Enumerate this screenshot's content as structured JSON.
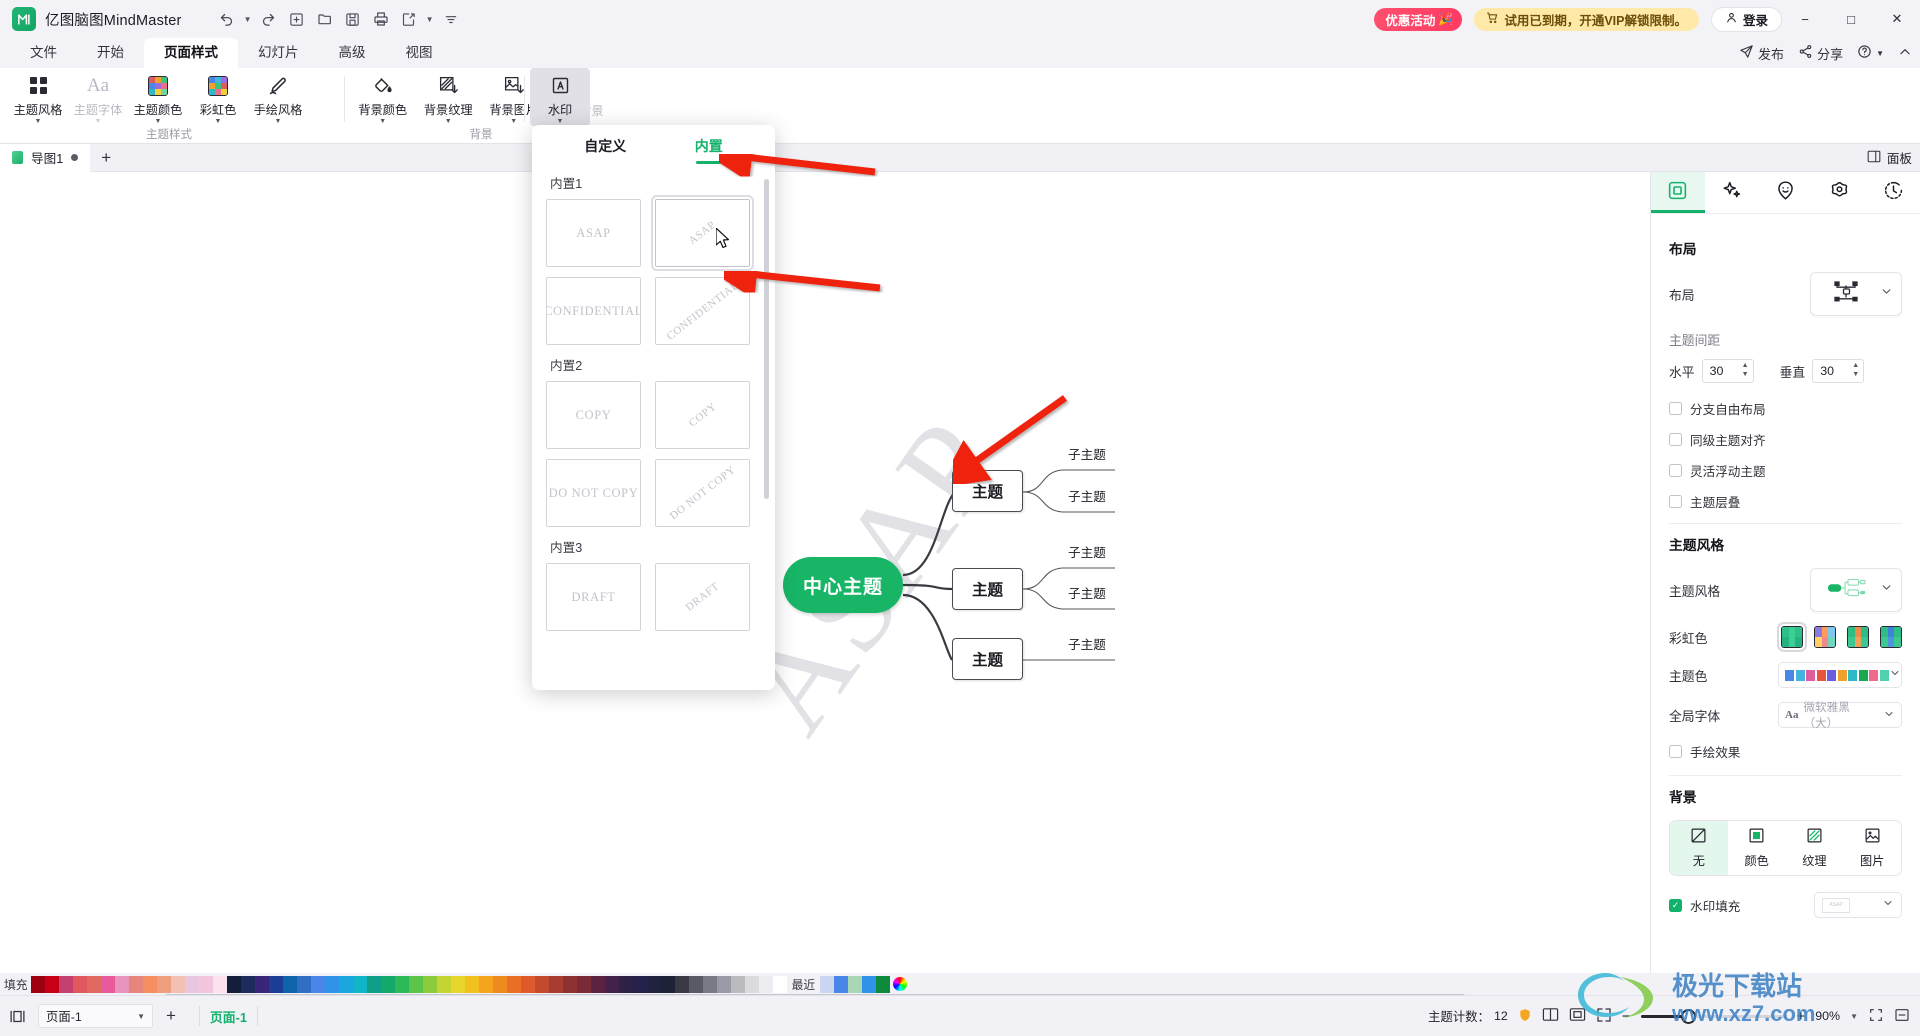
{
  "titlebar": {
    "app_name": "亿图脑图MindMaster",
    "logo_glyph": "M",
    "quick_access": [
      {
        "name": "undo-button",
        "glyph": "↶",
        "caret": true
      },
      {
        "name": "redo-button",
        "glyph": "↷",
        "caret": false
      },
      {
        "name": "new-button",
        "glyph": "⊞",
        "caret": false
      },
      {
        "name": "open-button",
        "glyph": "🗁",
        "caret": false
      },
      {
        "name": "save-button",
        "glyph": "🖫",
        "caret": false
      },
      {
        "name": "print-button",
        "glyph": "🖨",
        "caret": false
      },
      {
        "name": "export-button",
        "glyph": "🗇",
        "caret": true
      },
      {
        "name": "more-button",
        "glyph": "⩲",
        "caret": false
      }
    ],
    "promo_label": "优惠活动",
    "vip_label": "试用已到期，开通VIP解锁限制。",
    "login_label": "登录",
    "minimize": "−",
    "maximize": "□",
    "close": "✕"
  },
  "ribbon": {
    "tabs": [
      {
        "label": "文件",
        "active": false
      },
      {
        "label": "开始",
        "active": false
      },
      {
        "label": "页面样式",
        "active": true
      },
      {
        "label": "幻灯片",
        "active": false
      },
      {
        "label": "高级",
        "active": false
      },
      {
        "label": "视图",
        "active": false
      }
    ],
    "right_actions": [
      {
        "label": "发布",
        "icon": "send-icon"
      },
      {
        "label": "分享",
        "icon": "share-icon"
      },
      {
        "label": "",
        "icon": "help-icon"
      },
      {
        "label": "",
        "icon": "collapse-icon"
      }
    ],
    "groups": [
      {
        "name": "主题样式",
        "buttons": [
          {
            "label": "主题风格",
            "icon": "grid-icon",
            "disabled": false,
            "caret": true,
            "selected": false
          },
          {
            "label": "主题字体",
            "icon": "font-icon",
            "disabled": true,
            "caret": true,
            "selected": false
          },
          {
            "label": "主题颜色",
            "icon": "palette-icon",
            "disabled": false,
            "caret": true,
            "selected": false
          },
          {
            "label": "彩虹色",
            "icon": "rainbow-icon",
            "disabled": false,
            "caret": true,
            "selected": false
          },
          {
            "label": "手绘风格",
            "icon": "pen-icon",
            "disabled": false,
            "caret": true,
            "selected": false
          }
        ]
      },
      {
        "name": "背景",
        "buttons": [
          {
            "label": "背景颜色",
            "icon": "fill-icon",
            "disabled": false,
            "caret": true,
            "selected": false
          },
          {
            "label": "背景纹理",
            "icon": "texture-icon",
            "disabled": false,
            "caret": true,
            "selected": false
          },
          {
            "label": "背景图片",
            "icon": "image-icon",
            "disabled": false,
            "caret": true,
            "selected": false
          },
          {
            "label": "移除背景",
            "icon": "remove-image-icon",
            "disabled": true,
            "caret": false,
            "selected": false
          }
        ]
      },
      {
        "name": "",
        "buttons": [
          {
            "label": "水印",
            "icon": "watermark-icon",
            "disabled": false,
            "caret": true,
            "selected": true
          }
        ]
      }
    ]
  },
  "doc_tabs": {
    "tabs": [
      {
        "label": "导图1",
        "modified": true
      }
    ],
    "add_label": "+",
    "panel_label": "面板"
  },
  "watermark_panel": {
    "tabs": [
      {
        "label": "自定义",
        "active": false
      },
      {
        "label": "内置",
        "active": true
      }
    ],
    "groups": [
      {
        "title": "内置1",
        "items": [
          {
            "text": "ASAP",
            "diagonal": false,
            "selected": false
          },
          {
            "text": "ASAP",
            "diagonal": true,
            "selected": true
          },
          {
            "text": "CONFIDENTIAL",
            "diagonal": false,
            "selected": false
          },
          {
            "text": "CONFIDENTIAL",
            "diagonal": true,
            "selected": false
          }
        ]
      },
      {
        "title": "内置2",
        "items": [
          {
            "text": "COPY",
            "diagonal": false,
            "selected": false
          },
          {
            "text": "COPY",
            "diagonal": true,
            "selected": false
          },
          {
            "text": "DO NOT COPY",
            "diagonal": false,
            "selected": false
          },
          {
            "text": "DO NOT COPY",
            "diagonal": true,
            "selected": false
          }
        ]
      },
      {
        "title": "内置3",
        "items": [
          {
            "text": "DRAFT",
            "diagonal": false,
            "selected": false
          },
          {
            "text": "DRAFT",
            "diagonal": true,
            "selected": false
          }
        ]
      }
    ]
  },
  "canvas": {
    "watermark_text": "ASAP",
    "center_node": "中心主题",
    "branches": [
      {
        "label": "主题",
        "children": [
          "子主题",
          "子主题"
        ]
      },
      {
        "label": "主题",
        "children": [
          "子主题",
          "子主题"
        ]
      },
      {
        "label": "主题",
        "children": [
          "子主题"
        ]
      }
    ]
  },
  "sidebar": {
    "tabs": [
      {
        "name": "tab-layout",
        "icon": "square-icon",
        "active": true
      },
      {
        "name": "tab-ai",
        "icon": "sparkle-icon",
        "active": false
      },
      {
        "name": "tab-emoji",
        "icon": "smiley-icon",
        "active": false
      },
      {
        "name": "tab-settings",
        "icon": "gear-icon",
        "active": false
      },
      {
        "name": "tab-history",
        "icon": "clock-icon",
        "active": false
      }
    ],
    "layout_section": {
      "heading": "布局",
      "layout_label": "布局",
      "spacing_heading": "主题间距",
      "horizontal_label": "水平",
      "horizontal_value": "30",
      "vertical_label": "垂直",
      "vertical_value": "30",
      "checkboxes": [
        {
          "label": "分支自由布局",
          "checked": false
        },
        {
          "label": "同级主题对齐",
          "checked": false
        },
        {
          "label": "灵活浮动主题",
          "checked": false
        },
        {
          "label": "主题层叠",
          "checked": false
        }
      ]
    },
    "style_section": {
      "heading": "主题风格",
      "style_label": "主题风格",
      "rainbow_label": "彩虹色",
      "rainbow_swatches": [
        {
          "selected": true,
          "colors": [
            "#2fc08a",
            "#3ecf97",
            "#2fc08a",
            "#24b37f",
            "#3ecf97",
            "#24b37f"
          ]
        },
        {
          "selected": false,
          "colors": [
            "#8a7ae0",
            "#ff9a5a",
            "#7ec8f0",
            "#ffd166",
            "#f08a8a",
            "#6fd6c0"
          ]
        },
        {
          "selected": false,
          "colors": [
            "#2fbd85",
            "#f08a4b",
            "#2fbd85",
            "#3cc98f",
            "#f0a15c",
            "#3cc98f"
          ]
        },
        {
          "selected": false,
          "colors": [
            "#2fbd85",
            "#3b85d6",
            "#2fbd85",
            "#3cc98f",
            "#4f95de",
            "#3cc98f"
          ]
        }
      ],
      "theme_color_label": "主题色",
      "theme_colors": [
        "#4a86e8",
        "#45b3e0",
        "#e05c9e",
        "#e8533f",
        "#6b5ce0",
        "#f0a12b",
        "#2eb8c8",
        "#18a84f",
        "#ef6b8a",
        "#4fd1b0"
      ],
      "global_font_label": "全局字体",
      "global_font_value": "微软雅黑（大）",
      "hand_drawn_label": "手绘效果",
      "hand_drawn_checked": false
    },
    "background_section": {
      "heading": "背景",
      "options": [
        {
          "label": "无",
          "icon": "none-icon",
          "selected": true
        },
        {
          "label": "颜色",
          "icon": "color-icon",
          "selected": false
        },
        {
          "label": "纹理",
          "icon": "texture-icon",
          "selected": false
        },
        {
          "label": "图片",
          "icon": "image-icon",
          "selected": false
        }
      ],
      "watermark_fill_label": "水印填充",
      "watermark_fill_checked": true,
      "watermark_fill_value": "ASAP"
    }
  },
  "palette": {
    "fill_label": "填充",
    "recent_label": "最近",
    "colors": [
      "#9e0010",
      "#c70016",
      "#c4406f",
      "#e0575f",
      "#e06a62",
      "#e85a9c",
      "#e893bd",
      "#e8857a",
      "#f58e63",
      "#ef9f7e",
      "#f4c0b5",
      "#e8c6de",
      "#f2c7dd",
      "#fbe2ee",
      "#141d3a",
      "#1c2a5e",
      "#39267a",
      "#1a3e96",
      "#0f63ab",
      "#2f6fc4",
      "#4a86e8",
      "#2f93e8",
      "#1aa7dd",
      "#10b5c6",
      "#0e9e8a",
      "#15a86b",
      "#2db85a",
      "#5cc44a",
      "#8ccb3c",
      "#c3d433",
      "#e8d62c",
      "#f3c11f",
      "#f4a51d",
      "#ef8a1e",
      "#e86f24",
      "#de5a2a",
      "#c44a2e",
      "#a83c30",
      "#8e3133",
      "#7a2a35",
      "#5c2340",
      "#43214a",
      "#2e2146",
      "#24224a",
      "#202240",
      "#1d2236",
      "#3a3a44",
      "#5a5a66",
      "#7a7a86",
      "#9a9aa6",
      "#bababf",
      "#dadadf",
      "#ededf1",
      "#ffffff"
    ],
    "recent_colors": [
      "#cdd6f0",
      "#4a86e8",
      "#a9d6b5",
      "#2f93e8",
      "#0e8a3c"
    ]
  },
  "status": {
    "page_select_value": "页面-1",
    "add_page": "+",
    "page_name": "页面-1",
    "topic_count_label": "主题计数：",
    "topic_count_value": "12",
    "zoom_value": "90%",
    "zoom_minus": "−",
    "zoom_plus": "+"
  }
}
